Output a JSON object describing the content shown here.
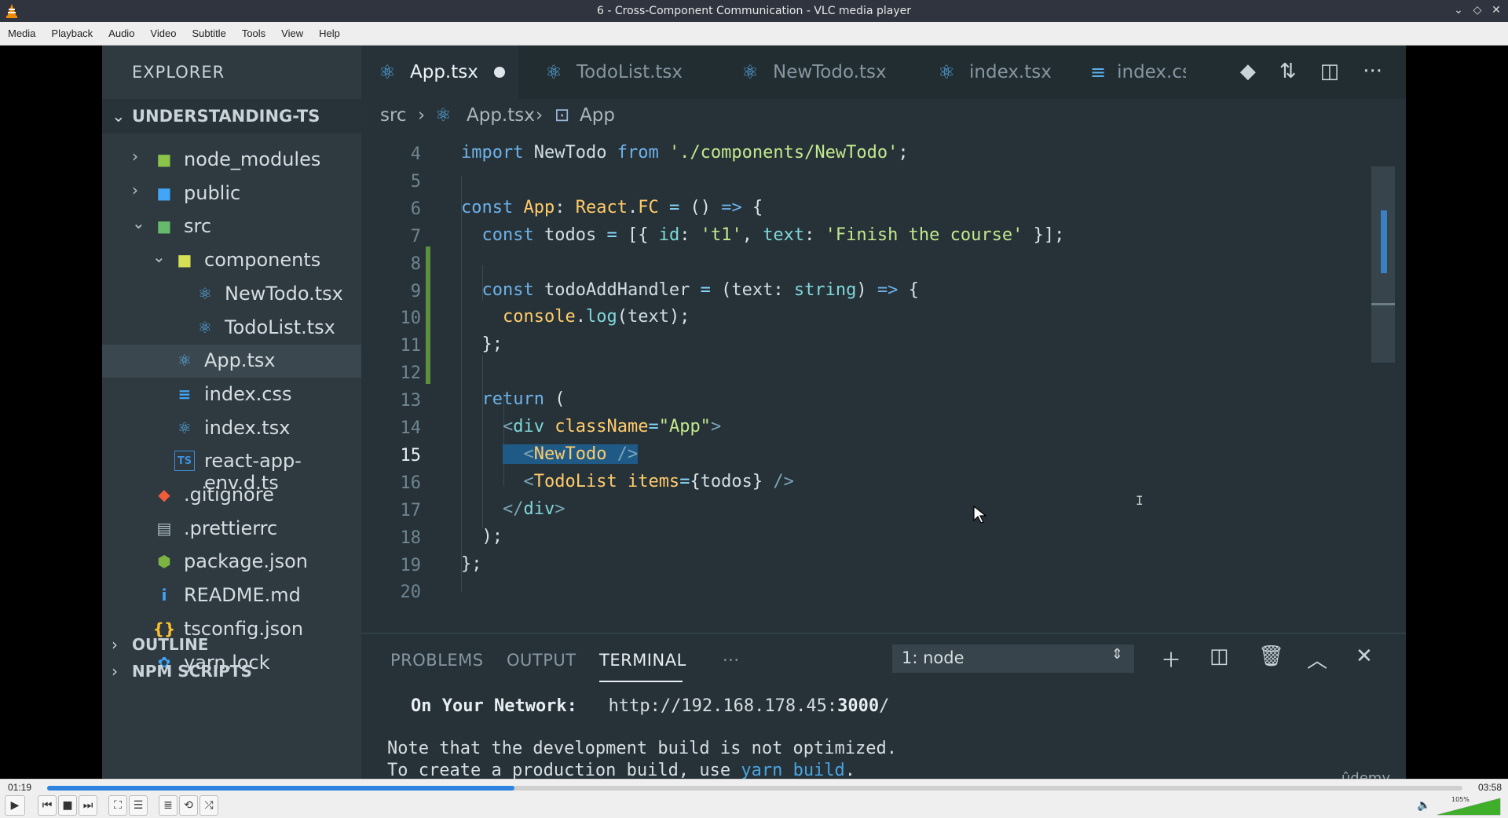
{
  "window": {
    "title": "6 - Cross-Component Communication - VLC media player"
  },
  "menu": [
    "Media",
    "Playback",
    "Audio",
    "Video",
    "Subtitle",
    "Tools",
    "View",
    "Help"
  ],
  "player": {
    "elapsed": "01:19",
    "total": "03:58",
    "progress_percent": 33,
    "volume_label": "105%",
    "volume_percent": 100
  },
  "vscode": {
    "explorer_title": "EXPLORER",
    "project": "UNDERSTANDING-TS",
    "tree": [
      {
        "label": "node_modules",
        "indent": 0,
        "chev": "›",
        "icon": "folder-node-icon",
        "glyph": "■",
        "color": "#8bc34a"
      },
      {
        "label": "public",
        "indent": 0,
        "chev": "›",
        "icon": "folder-public-icon",
        "glyph": "■",
        "color": "#42a5f5"
      },
      {
        "label": "src",
        "indent": 0,
        "chev": "⌄",
        "icon": "folder-src-icon",
        "glyph": "■",
        "color": "#66bb6a"
      },
      {
        "label": "components",
        "indent": 1,
        "chev": "⌄",
        "icon": "folder-components-icon",
        "glyph": "■",
        "color": "#d4e157"
      },
      {
        "label": "NewTodo.tsx",
        "indent": 2,
        "chev": "",
        "icon": "react-icon",
        "glyph": "⚛",
        "color": "#5aaee8"
      },
      {
        "label": "TodoList.tsx",
        "indent": 2,
        "chev": "",
        "icon": "react-icon",
        "glyph": "⚛",
        "color": "#5aaee8"
      },
      {
        "label": "App.tsx",
        "indent": 1,
        "chev": "",
        "icon": "react-icon",
        "glyph": "⚛",
        "color": "#5aaee8",
        "active": true
      },
      {
        "label": "index.css",
        "indent": 1,
        "chev": "",
        "icon": "css-icon",
        "glyph": "≡",
        "color": "#42a5f5"
      },
      {
        "label": "index.tsx",
        "indent": 1,
        "chev": "",
        "icon": "react-icon",
        "glyph": "⚛",
        "color": "#5aaee8"
      },
      {
        "label": "react-app-env.d.ts",
        "indent": 1,
        "chev": "",
        "icon": "typescript-icon",
        "glyph": "TS",
        "color": "#3f8ed8"
      },
      {
        "label": ".gitignore",
        "indent": 0,
        "chev": "",
        "icon": "git-icon",
        "glyph": "◆",
        "color": "#ef5b3b"
      },
      {
        "label": ".prettierrc",
        "indent": 0,
        "chev": "",
        "icon": "prettier-icon",
        "glyph": "▤",
        "color": "#b0bec5"
      },
      {
        "label": "package.json",
        "indent": 0,
        "chev": "",
        "icon": "nodejs-icon",
        "glyph": "⬢",
        "color": "#7cb342"
      },
      {
        "label": "README.md",
        "indent": 0,
        "chev": "",
        "icon": "info-icon",
        "glyph": "i",
        "color": "#42a5f5"
      },
      {
        "label": "tsconfig.json",
        "indent": 0,
        "chev": "",
        "icon": "json-icon",
        "glyph": "{}",
        "color": "#fbc02d"
      },
      {
        "label": "yarn.lock",
        "indent": 0,
        "chev": "",
        "icon": "yarn-icon",
        "glyph": "✿",
        "color": "#42a5f5"
      }
    ],
    "sections": [
      "OUTLINE",
      "NPM SCRIPTS"
    ],
    "tabs": [
      {
        "label": "App.tsx",
        "active": true,
        "dirty": true,
        "icon": "react-icon",
        "glyph": "⚛"
      },
      {
        "label": "TodoList.tsx",
        "icon": "react-icon",
        "glyph": "⚛"
      },
      {
        "label": "NewTodo.tsx",
        "icon": "react-icon",
        "glyph": "⚛"
      },
      {
        "label": "index.tsx",
        "icon": "react-icon",
        "glyph": "⚛"
      },
      {
        "label": "index.cs",
        "icon": "css-icon",
        "glyph": "≡"
      }
    ],
    "breadcrumb": {
      "folder": "src",
      "file": "App.tsx",
      "symbol": "App"
    },
    "current_line": 15,
    "code": [
      {
        "n": "4",
        "html": "<span class=\"k\">import</span> <span class=\"v\">NewTodo</span> <span class=\"k\">from</span> <span class=\"s\">'./components/NewTodo'</span>;"
      },
      {
        "n": "5",
        "html": ""
      },
      {
        "n": "6",
        "html": "<span class=\"k\">const</span> <span class=\"t\">App</span>: <span class=\"t\">React</span>.<span class=\"t\">FC</span> <span class=\"p\">=</span> () <span class=\"k\">=&gt;</span> {"
      },
      {
        "n": "7",
        "html": "  <span class=\"k\">const</span> <span class=\"v\">todos</span> <span class=\"p\">=</span> [{ <span class=\"f\">id</span>: <span class=\"s\">'t1'</span>, <span class=\"f\">text</span>: <span class=\"s\">'Finish the course'</span> }];"
      },
      {
        "n": "8",
        "html": ""
      },
      {
        "n": "9",
        "html": "  <span class=\"k\">const</span> <span class=\"v\">todoAddHandler</span> <span class=\"p\">=</span> (<span class=\"v\">text</span>: <span class=\"f\">string</span>) <span class=\"k\">=&gt;</span> {"
      },
      {
        "n": "10",
        "html": "    <span class=\"t\">console</span>.<span class=\"f\">log</span>(<span class=\"v\">text</span>);"
      },
      {
        "n": "11",
        "html": "  };"
      },
      {
        "n": "12",
        "html": ""
      },
      {
        "n": "13",
        "html": "  <span class=\"k\">return</span> ("
      },
      {
        "n": "14",
        "html": "    <span class=\"tag\">&lt;</span><span class=\"f\">div</span> <span class=\"t\">className</span><span class=\"p\">=</span><span class=\"s\">\"App\"</span><span class=\"tag\">&gt;</span>"
      },
      {
        "n": "15",
        "html": "    <span class=\"sel\">  <span class=\"tag\">&lt;</span><span class=\"t\">NewTodo</span> <span class=\"tag\">/&gt;</span></span>"
      },
      {
        "n": "16",
        "html": "      <span class=\"tag\">&lt;</span><span class=\"t\">TodoList</span> <span class=\"t\">items</span><span class=\"p\">=</span>{<span class=\"v\">todos</span>} <span class=\"tag\">/&gt;</span>"
      },
      {
        "n": "17",
        "html": "    <span class=\"tag\">&lt;/</span><span class=\"f\">div</span><span class=\"tag\">&gt;</span>"
      },
      {
        "n": "18",
        "html": "  );"
      },
      {
        "n": "19",
        "html": "};"
      },
      {
        "n": "20",
        "html": ""
      }
    ],
    "panel": {
      "tabs": [
        "PROBLEMS",
        "OUTPUT",
        "TERMINAL",
        "···"
      ],
      "active_tab": "TERMINAL",
      "terminal_select": "1: node",
      "terminal_network_label": "On Your Network:",
      "terminal_network_url": "http://192.168.178.45:",
      "terminal_network_port": "3000",
      "terminal_network_tail": "/",
      "terminal_note1": "Note that the development build is not optimized.",
      "terminal_note2_pre": "To create a production build, use ",
      "terminal_note2_cmd": "yarn build",
      "terminal_note2_post": "."
    },
    "watermark": "ûdemy"
  }
}
